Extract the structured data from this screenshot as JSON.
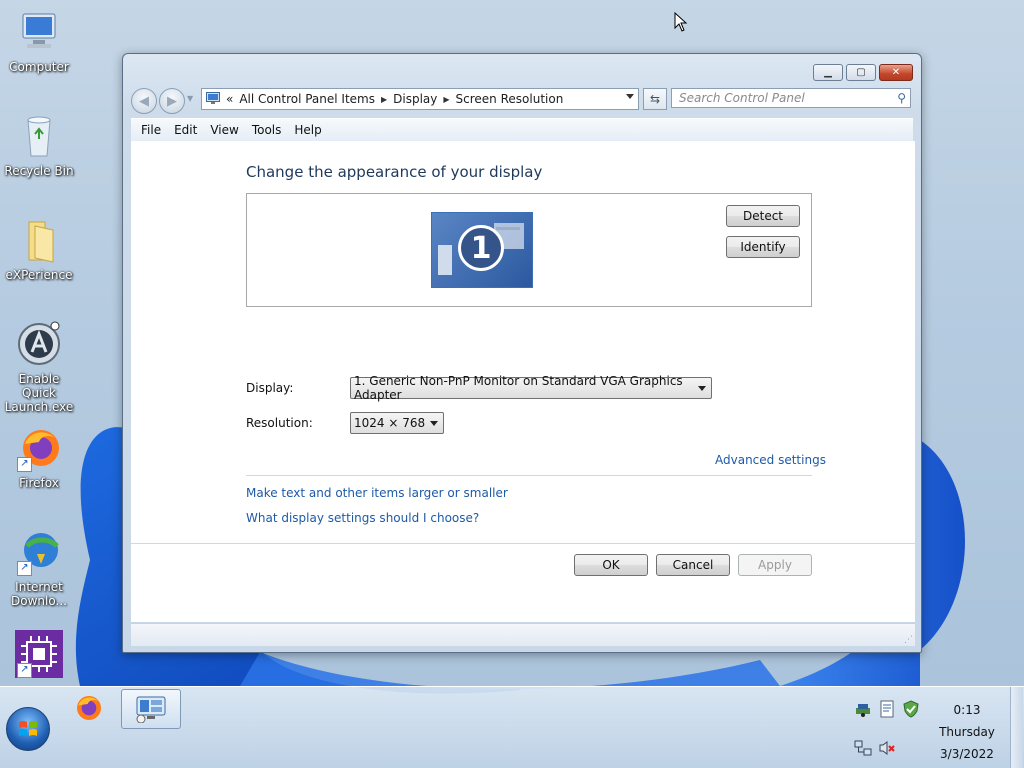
{
  "desktop": {
    "icons": [
      {
        "label": "Computer",
        "icon": "computer-icon"
      },
      {
        "label": "Recycle Bin",
        "icon": "recycle-bin-icon"
      },
      {
        "label": "eXPerience",
        "icon": "folder-icon"
      },
      {
        "label": "Enable Quick Launch.exe",
        "icon": "quick-launch-icon"
      },
      {
        "label": "Firefox",
        "icon": "firefox-icon"
      },
      {
        "label": "Internet Downlo...",
        "icon": "download-manager-icon"
      },
      {
        "label": "",
        "icon": "cpu-icon"
      }
    ]
  },
  "window": {
    "address": {
      "prefix": "«",
      "crumbs": [
        "All Control Panel Items",
        "Display",
        "Screen Resolution"
      ]
    },
    "search_placeholder": "Search Control Panel",
    "menu": [
      "File",
      "Edit",
      "View",
      "Tools",
      "Help"
    ],
    "heading": "Change the appearance of your display",
    "monitor_number": "1",
    "buttons": {
      "detect": "Detect",
      "identify": "Identify",
      "ok": "OK",
      "cancel": "Cancel",
      "apply": "Apply"
    },
    "display_label": "Display:",
    "display_value": "1. Generic Non-PnP Monitor on Standard VGA Graphics Adapter",
    "resolution_label": "Resolution:",
    "resolution_value": "1024 × 768",
    "links": {
      "advanced": "Advanced settings",
      "larger_text": "Make text and other items larger or smaller",
      "help": "What display settings should I choose?"
    }
  },
  "taskbar": {
    "clock": {
      "time": "0:13",
      "day": "Thursday",
      "date": "3/3/2022"
    }
  },
  "colors": {
    "link": "#1e5aa8",
    "heading": "#1e395b"
  }
}
